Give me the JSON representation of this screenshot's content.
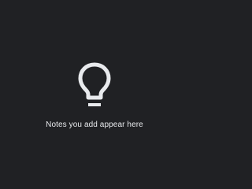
{
  "empty_state": {
    "icon": "lightbulb-icon",
    "message": "Notes you add appear here"
  },
  "colors": {
    "background": "#202124",
    "icon": "#e8eaed",
    "text": "#e8eaed"
  }
}
